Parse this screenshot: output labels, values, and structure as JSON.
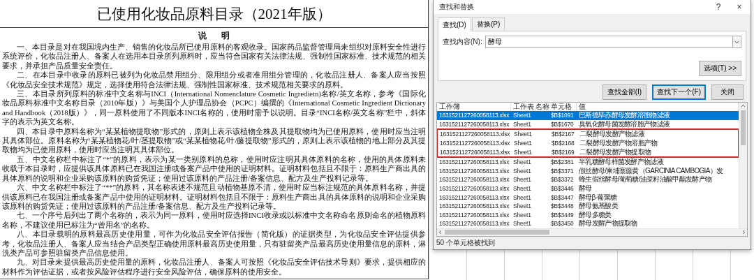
{
  "document": {
    "title": "已使用化妆品原料目录（2021年版）",
    "heading": "说 明",
    "paragraphs": [
      "一、本目录是对在我国境内生产、销售的化妆品所已使用原料的客观收录。国家药品监督管理局未组织对原料安全性进行系统评价，化妆品注册人、备案人在选用本目录所列原料时，应当符合国家有关法律法规、强制性国家标准、技术规范的相关要求，并承担产品质量安全责任。",
      "二、在本目录中收录的原料已被列为化妆品禁用组分、限用组分或者准用组分管理的，化妆品注册人、备案人应当按照《化妆品安全技术规范》规定，选择使用符合法律法规、强制性国家标准、技术规范相关要求的原料。",
      "三、本目录所列原料的标准中文名称与INCI（International Nomenclature Cosmetic Ingredietn)名称/英文名称，参考《国际化妆品原料标准中文名称目录（2010年版）》与美国个人护理品协会（PCPC）编撰的《International Cosmetic Ingredient Dictionary and Handbook（2018版）》，同一原料使用了不同版本INCI名称的，使用时需予以说明。目录“INCI名称/英文名称”栏中，斜体字的表示为英文名称。",
      "四、本目录中原料名称为“某某植物提取物”形式的，原则上表示该植物全株及其提取物均为已使用原料，使用时应当注明其具体部位。原料名称为“某某植物花/叶/茎提取物”或“某某植物花/叶/藤提取物”形式的，原则上表示该植物的地上部分及其提取物均为已使用原料，使用时应当注明其具体部位。",
      "五、中文名称栏中标注了“*”的原料，表示为某一类别原料的总称，使用时应注明其具体原料的名称，使用的具体原料未收载于本目录时，应提供该具体原料已在我国注册或备案产品中使用的证明材料。证明材料包括且不限于：原料生产商出具的具体原料的说明和企业采购该原料的购货凭证；使用过该原料的产品注册/备案信息、配方及生产投料记录等。",
      "六、中文名称栏中标注了“**”的原料，其名称表述不规范且动植物基原不清，使用时应当标注规范的具体原料名称，并提供该原料已在我国注册或备案产品中使用的证明材料。证明材料包括且不限于：原料生产商出具的具体原料的说明和企业采购该原料的购货凭证；使用过该原料的产品注册/备案信息、配方及生产投料记录等。",
      "七、一个序号后列出了两个名称的，表示为同一原料，使用时应选择INCI收录或以标准中文名称命名原则命名的植物原料名称，不建议使用已标注为“曾用名”的名称。",
      "八、本目录载明的原料最高历史使用量，可作为化妆品安全评估报告（简化版）的证据类型，为化妆品安全评估提供参考，化妆品注册人、备案人应当结合产品类型正确使用原料最高历史使用量，只有驻留类产品最高历史使用量信息的原料，淋洗类产品可参照驻留类产品信息使用。",
      "九、对目录未提供最高历史使用量的原料，化妆品注册人、备案人可按照《化妆品安全评估技术导则》要求，提供相应的材料作为评估证据，或者按风险评估程序进行安全风险评估，确保原料的使用安全。"
    ]
  },
  "dialog": {
    "title": "查找和替换",
    "help": "?",
    "close": "×",
    "tabs": [
      {
        "label": "查找(D)",
        "selected": true
      },
      {
        "label": "替换(P)",
        "selected": false
      }
    ],
    "find_label": "查找内容(N):",
    "find_value": "酵母",
    "options_button": "选项(T) >>",
    "buttons": [
      {
        "label": "查找全部(I)",
        "focused": false
      },
      {
        "label": "查找下一个(F)",
        "focused": true
      },
      {
        "label": "关闭",
        "focused": false
      }
    ],
    "results": {
      "columns": [
        "工作簿",
        "工作表",
        "名称",
        "单元格",
        "值"
      ],
      "rows": [
        {
          "workbook": "1631521127260058113.xlsx",
          "sheet": "Sheet1",
          "cell": "$B$1091",
          "value": "巴斯德毕赤酵母发酵溶胞物滤液",
          "selected": true,
          "highlighted": false
        },
        {
          "workbook": "1631521127260058113.xlsx",
          "sheet": "Sheet1",
          "cell": "$B$1670",
          "value": "臭氧化酵母菌发酵溶胞产物滤液",
          "selected": false,
          "highlighted": false
        },
        {
          "workbook": "1631521127260058113.xlsx",
          "sheet": "Sheet1",
          "cell": "$B$2167",
          "value": "二裂酵母发酵产物滤液",
          "selected": false,
          "highlighted": true
        },
        {
          "workbook": "1631521127260058113.xlsx",
          "sheet": "Sheet1",
          "cell": "$B$2168",
          "value": "二裂酵母发酵产物溶胞产物",
          "selected": false,
          "highlighted": true
        },
        {
          "workbook": "1631521127260058113.xlsx",
          "sheet": "Sheet1",
          "cell": "$B$2169",
          "value": "二裂酵母发酵产物提取物",
          "selected": false,
          "highlighted": true
        },
        {
          "workbook": "1631521127260058113.xlsx",
          "sheet": "Sheet1",
          "cell": "$B$2381",
          "value": "半乳糖酵母样菌发酵产物滤液",
          "selected": false,
          "highlighted": false
        },
        {
          "workbook": "1631521127260058113.xlsx",
          "sheet": "Sheet1",
          "cell": "$B$3371",
          "value": "假丝酵母/柬埔寨藤黄（GARCINIA CAMBOGIA）发",
          "selected": false,
          "highlighted": false
        },
        {
          "workbook": "1631521127260058113.xlsx",
          "sheet": "Sheet1",
          "cell": "$B$3372",
          "value": "蜂生假丝酵母/葡萄糖/油菜籽油酸甲酯发酵产物",
          "selected": false,
          "highlighted": false
        },
        {
          "workbook": "1631521127260058113.xlsx",
          "sheet": "Sheet1",
          "cell": "$B$3446",
          "value": "酵母",
          "selected": false,
          "highlighted": false
        },
        {
          "workbook": "1631521127260058113.xlsx",
          "sheet": "Sheet1",
          "cell": "$B$3447",
          "value": "酵母β-葡聚糖",
          "selected": false,
          "highlighted": false
        },
        {
          "workbook": "1631521127260058113.xlsx",
          "sheet": "Sheet1",
          "cell": "$B$3448",
          "value": "酵母氨基酸类",
          "selected": false,
          "highlighted": false
        },
        {
          "workbook": "1631521127260058113.xlsx",
          "sheet": "Sheet1",
          "cell": "$B$3449",
          "value": "酵母多糖类",
          "selected": false,
          "highlighted": false
        },
        {
          "workbook": "1631521127260058113.xlsx",
          "sheet": "Sheet1",
          "cell": "$B$3450",
          "value": "酵母发酵产物提取物",
          "selected": false,
          "highlighted": false
        }
      ]
    },
    "status": "50 个单元格被找到"
  }
}
